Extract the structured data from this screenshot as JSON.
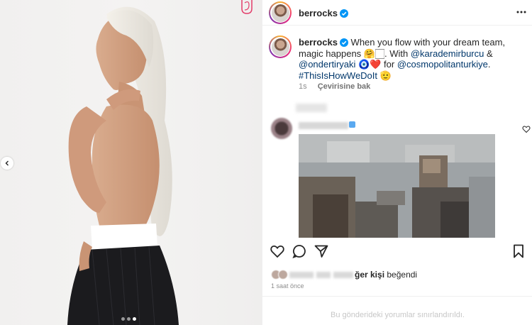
{
  "post": {
    "username": "berrocks",
    "verified": true,
    "more_icon": "more-horizontal-icon",
    "media": {
      "carousel_dots": 3,
      "active_dot": 2,
      "prev_icon": "chevron-left-icon"
    },
    "caption": {
      "text_1": "When you flow with your dream team, magic happens",
      "emoji_1": "🤗🏻",
      "text_2": ". With",
      "mention_1": "@karademirburcu",
      "text_3": "&",
      "mention_2": "@ondertiryaki",
      "emoji_2": "🧿❤️",
      "text_4": "for",
      "mention_3": "@cosmopolitanturkiye",
      "text_5": ".",
      "hashtag": "#ThisIsHowWeDoIt",
      "emoji_3": "🫡"
    },
    "meta": {
      "time": "1s",
      "translate": "Çevirisine bak"
    },
    "likes_text": "ğer kişi",
    "likes_suffix": "beğendi",
    "posted_time": "1 saat önce",
    "footer_text": "Bu gönderideki yorumlar sınırlandırıldı."
  },
  "colors": {
    "link": "#00376b",
    "text": "#262626",
    "muted": "#8e8e8e",
    "verified": "#0095f6",
    "footer": "#c7c7c7"
  }
}
